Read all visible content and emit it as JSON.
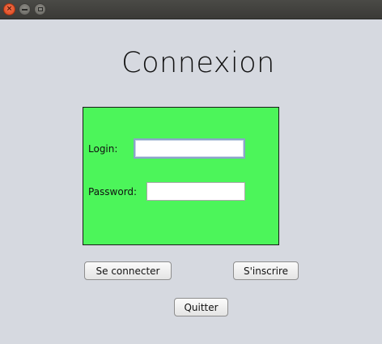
{
  "window": {
    "close_glyph": "×"
  },
  "header": {
    "title": "Connexion"
  },
  "form": {
    "login_label": "Login:",
    "login_value": "",
    "password_label": "Password:",
    "password_value": ""
  },
  "actions": {
    "connect_label": "Se connecter",
    "register_label": "S'inscrire",
    "quit_label": "Quitter"
  },
  "colors": {
    "background": "#d6d9e0",
    "form_panel": "#4cf55a",
    "close_button": "#e9501f",
    "focus_border": "#8aa4c8"
  }
}
